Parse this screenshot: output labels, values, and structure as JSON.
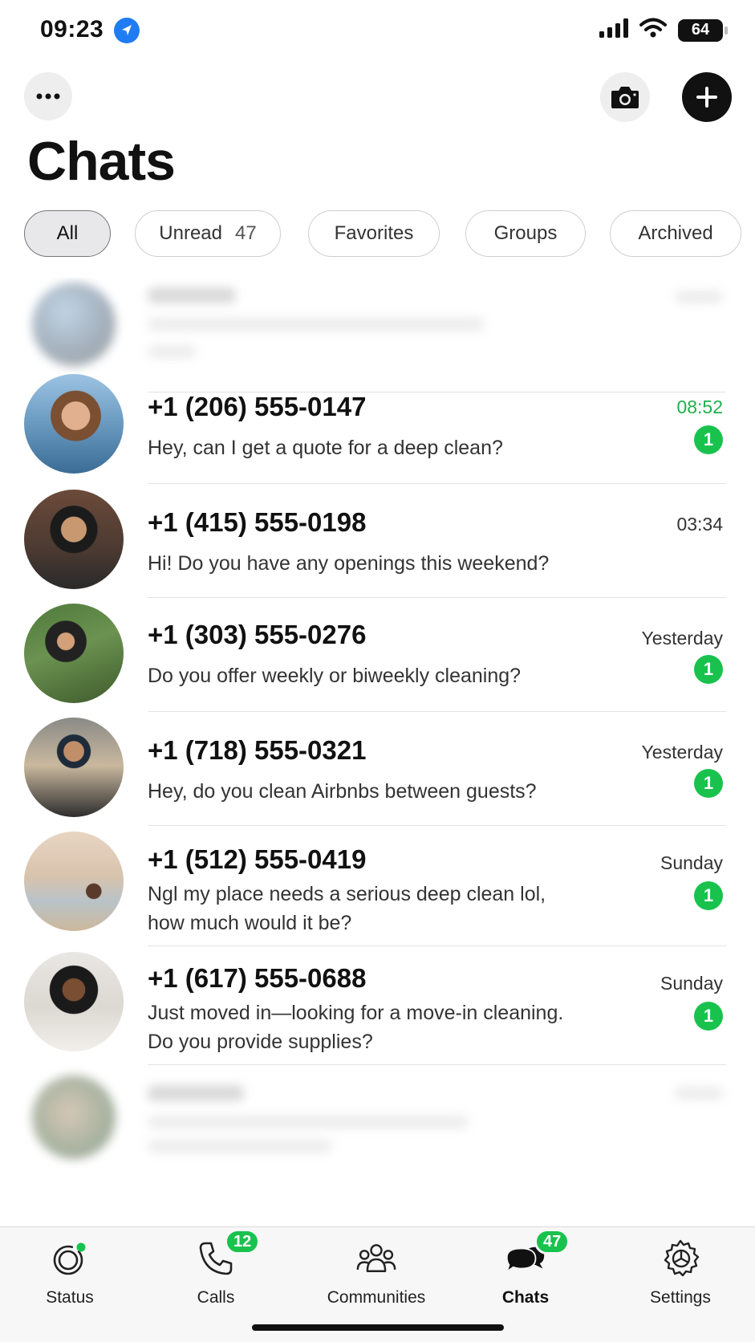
{
  "status_bar": {
    "time": "09:23",
    "battery": "64"
  },
  "header": {
    "title": "Chats"
  },
  "filters": [
    {
      "label": "All",
      "count": ""
    },
    {
      "label": "Unread",
      "count": "47"
    },
    {
      "label": "Favorites",
      "count": ""
    },
    {
      "label": "Groups",
      "count": ""
    },
    {
      "label": "Archived",
      "count": ""
    }
  ],
  "chats": [
    {
      "name": "+1 (206) 555-0147",
      "time": "08:52",
      "message": "Hey, can I get a quote for a deep clean?",
      "unread": "1"
    },
    {
      "name": "+1 (415) 555-0198",
      "time": "03:34",
      "message": "Hi! Do you have any openings this weekend?",
      "unread": ""
    },
    {
      "name": "+1 (303) 555-0276",
      "time": "Yesterday",
      "message": "Do you offer weekly or biweekly cleaning?",
      "unread": "1"
    },
    {
      "name": "+1 (718) 555-0321",
      "time": "Yesterday",
      "message": "Hey, do you clean Airbnbs between guests?",
      "unread": "1"
    },
    {
      "name": "+1 (512) 555-0419",
      "time": "Sunday",
      "message": "Ngl my place needs a serious deep clean lol, how much would it be?",
      "unread": "1"
    },
    {
      "name": "+1 (617) 555-0688",
      "time": "Sunday",
      "message": "Just moved in—looking for a move-in cleaning. Do you provide supplies?",
      "unread": "1"
    }
  ],
  "tabs": [
    {
      "label": "Status",
      "icon": "status-icon",
      "badge": ""
    },
    {
      "label": "Calls",
      "icon": "phone-icon",
      "badge": "12"
    },
    {
      "label": "Communities",
      "icon": "communities-icon",
      "badge": ""
    },
    {
      "label": "Chats",
      "icon": "chats-icon",
      "badge": "47"
    },
    {
      "label": "Settings",
      "icon": "gear-icon",
      "badge": ""
    }
  ],
  "colors": {
    "accent_green": "#19c24d",
    "time_green": "#1fb04a"
  }
}
